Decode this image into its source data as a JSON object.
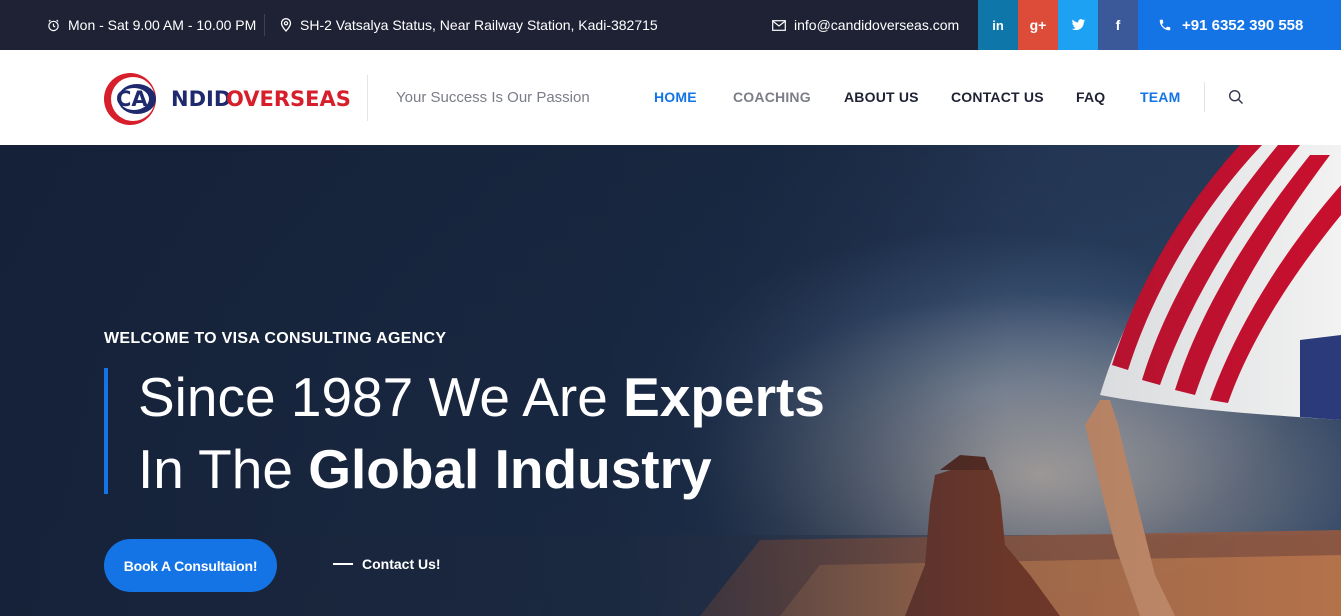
{
  "topbar": {
    "hours": "Mon - Sat 9.00 AM - 10.00 PM",
    "address": "SH-2 Vatsalya Status, Near Railway Station, Kadi-382715",
    "email": "info@candidoverseas.com",
    "phone": "+91 6352 390 558",
    "social": {
      "linkedin": "in",
      "googleplus": "g+",
      "twitter_icon": "twitter-icon",
      "facebook": "f"
    },
    "colors": {
      "bg": "#1f2235",
      "linkedin": "#0e76a8",
      "googleplus": "#dd4b39",
      "twitter": "#1da1f2",
      "facebook": "#3b5998",
      "phone": "#1474e6"
    }
  },
  "header": {
    "logo": {
      "ca": "CA",
      "ndid": "NDID",
      "overseas": "OVERSEAS"
    },
    "tagline": "Your Success Is Our Passion",
    "nav": {
      "home": "HOME",
      "coaching": "COACHING",
      "about": "ABOUT US",
      "contact": "CONTACT US",
      "faq": "FAQ",
      "team": "TEAM"
    },
    "search_icon": "search-icon"
  },
  "hero": {
    "kicker": "WELCOME TO VISA CONSULTING AGENCY",
    "line1_regular": "Since 1987 We Are ",
    "line1_bold": "Experts",
    "line2_regular": "In The ",
    "line2_bold": "Global Industry",
    "cta_primary": "Book A Consultaion!",
    "cta_secondary": "Contact Us!",
    "accent": "#1474e6"
  }
}
